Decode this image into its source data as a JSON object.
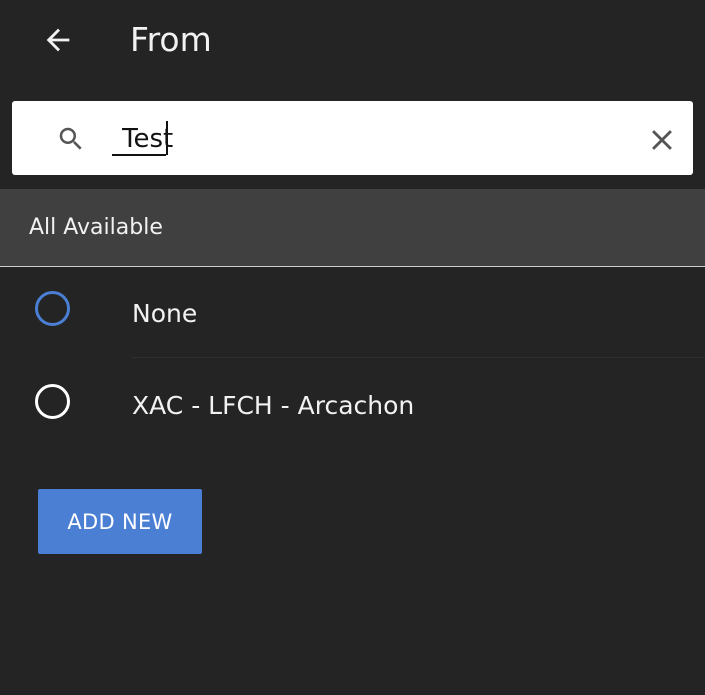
{
  "header": {
    "title": "From",
    "back_icon": "arrow-left-icon"
  },
  "search": {
    "value": "Test",
    "placeholder": "",
    "search_icon": "search-icon",
    "clear_icon": "close-icon"
  },
  "section": {
    "label": "All Available"
  },
  "options": [
    {
      "label": "None",
      "selected": false,
      "focused": true
    },
    {
      "label": "XAC - LFCH - Arcachon",
      "selected": false,
      "focused": false
    }
  ],
  "actions": {
    "add_new_label": "ADD NEW"
  },
  "colors": {
    "background": "#242424",
    "section_background": "#404040",
    "accent": "#4a7fd4",
    "radio_focused": "#4a7fd4",
    "radio_default": "#ffffff"
  }
}
